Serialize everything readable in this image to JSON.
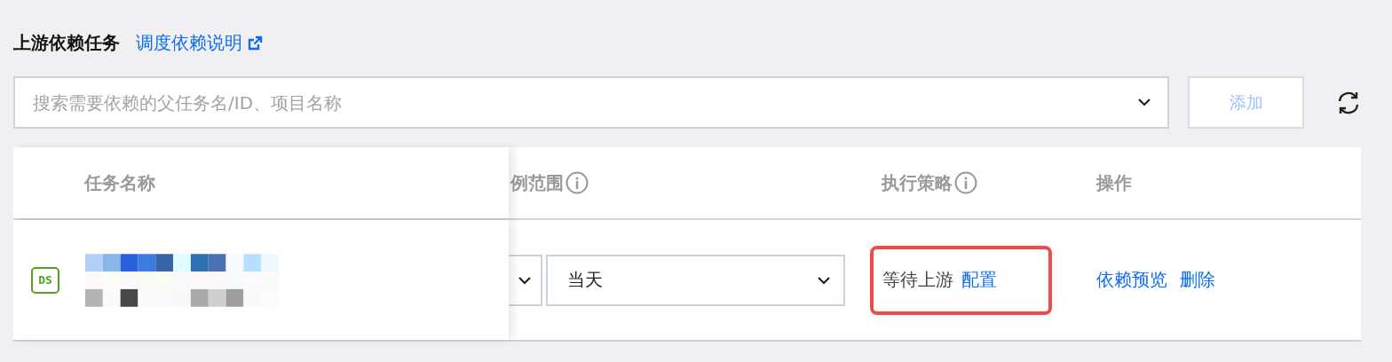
{
  "section": {
    "title": "上游依赖任务",
    "help_link": "调度依赖说明"
  },
  "search": {
    "placeholder": "搜索需要依赖的父任务名/ID、项目名称"
  },
  "add_button": {
    "label": "添加",
    "disabled": true
  },
  "table": {
    "columns": [
      {
        "label": "任务名称",
        "info": false
      },
      {
        "label": "例范围",
        "info": true
      },
      {
        "label": "执行策略",
        "info": true
      },
      {
        "label": "操作",
        "info": false
      }
    ],
    "rows": [
      {
        "badge": "DS",
        "range": "当天",
        "strategy": "等待上游",
        "strategy_link": "配置",
        "highlighted": true,
        "actions": [
          "依赖预览",
          "删除"
        ]
      }
    ]
  }
}
